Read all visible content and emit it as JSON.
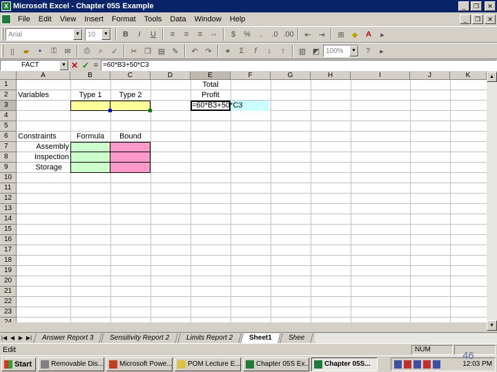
{
  "window": {
    "title": "Microsoft Excel - Chapter 05S Example"
  },
  "menu": [
    "File",
    "Edit",
    "View",
    "Insert",
    "Format",
    "Tools",
    "Data",
    "Window",
    "Help"
  ],
  "toolbar": {
    "font_name": "Arial",
    "font_size": "10",
    "zoom": "100%"
  },
  "formula_bar": {
    "name_box": "FACT",
    "formula": "=60*B3+50*C3"
  },
  "columns": [
    "A",
    "B",
    "C",
    "D",
    "E",
    "F",
    "G",
    "H",
    "I",
    "J",
    "K"
  ],
  "rows": [
    "1",
    "2",
    "3",
    "4",
    "5",
    "6",
    "7",
    "8",
    "9",
    "10",
    "11",
    "12",
    "13",
    "14",
    "15",
    "16",
    "17",
    "18",
    "19",
    "20",
    "21",
    "22",
    "23",
    "24"
  ],
  "cells": {
    "e1": "Total",
    "a2": "Variables",
    "b2": "Type 1",
    "c2": "Type 2",
    "e2": "Profit",
    "e3": "=60*B3+50*C3",
    "a6": "Constraints",
    "b6": "Formula",
    "c6": "Bound",
    "a7": "Assembly",
    "a8": "Inspection",
    "a9": "Storage"
  },
  "sheet_tabs": [
    "Answer Report 3",
    "Sensitivity Report 2",
    "Limits Report 2",
    "Sheet1",
    "Shee"
  ],
  "status": {
    "mode": "Edit",
    "num": "NUM"
  },
  "taskbar": {
    "start": "Start",
    "tasks": [
      "Removable Dis...",
      "Microsoft Powe...",
      "POM Lecture E...",
      "Chapter 05S Ex...",
      "Chapter 05S..."
    ],
    "clock": "12:03 PM"
  },
  "slide_number": "46",
  "colors": {
    "title_bar": "#0a246a",
    "input_yellow": "#ffff99",
    "formula_green": "#ccffcc",
    "bound_pink": "#ff99cc",
    "edit_cyan": "#ccffff"
  }
}
